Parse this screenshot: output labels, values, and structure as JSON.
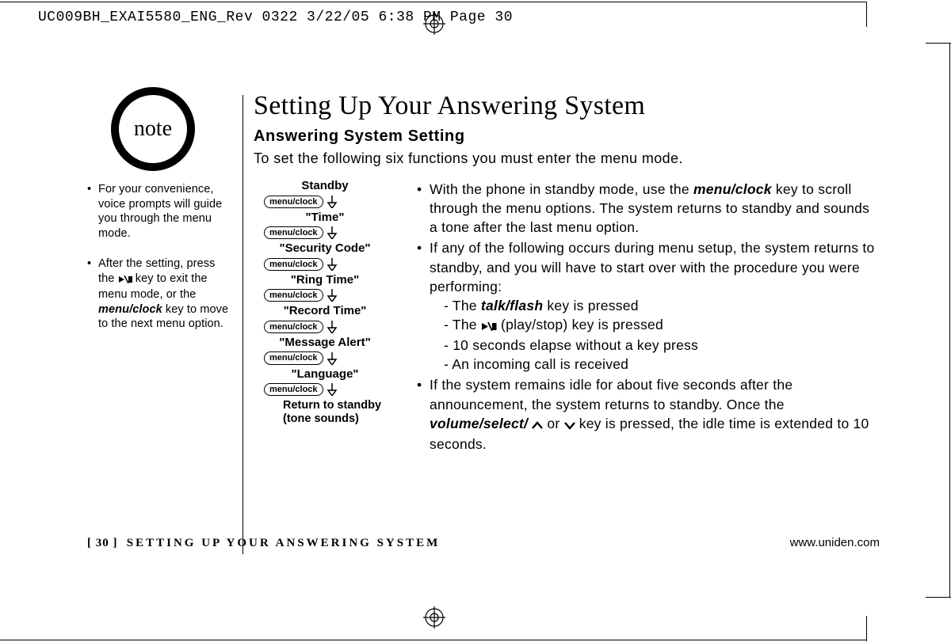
{
  "slug": "UC009BH_EXAI5580_ENG_Rev 0322  3/22/05  6:38 PM  Page 30",
  "note_badge": "note",
  "side_notes": {
    "item1": "For your convenience, voice prompts will guide you through the menu mode.",
    "item2_a": "After the setting, press the ",
    "item2_b": " key to exit the menu mode, or the ",
    "item2_c": "menu/clock",
    "item2_d": " key to move to the next menu option."
  },
  "headings": {
    "h1": "Setting Up Your Answering System",
    "h2": "Answering System Setting",
    "intro": "To set the following six functions you must enter the menu mode."
  },
  "button_label": "menu/clock",
  "flow": {
    "s0": "Standby",
    "s1": "\"Time\"",
    "s2": "\"Security Code\"",
    "s3": "\"Ring Time\"",
    "s4": "\"Record Time\"",
    "s5": "\"Message Alert\"",
    "s6": "\"Language\"",
    "final1": "Return to standby",
    "final2": "(tone sounds)"
  },
  "body": {
    "b1_a": "With the phone in standby mode, use the ",
    "b1_key": "menu/clock",
    "b1_b": " key to scroll through the menu options. The system returns to standby and sounds a tone after the last menu option.",
    "b2_a": "If any of the following occurs during menu setup, the system returns to standby, and you will have to start over with the procedure you were performing:",
    "b2_s1_a": "The ",
    "b2_s1_key": "talk/flash",
    "b2_s1_b": " key is pressed",
    "b2_s2_a": "The ",
    "b2_s2_b": " (play/stop) key is pressed",
    "b2_s3": "10 seconds elapse without a key press",
    "b2_s4": "An incoming call is received",
    "b3_a": "If the system remains idle for about five seconds after the announcement, the system returns to standby. Once the ",
    "b3_key": "volume/select/",
    "b3_b": " or ",
    "b3_c": " key is pressed, the idle time is extended to 10 seconds."
  },
  "footer": {
    "page_bracket": "[ 30 ]",
    "section": "SETTING UP YOUR ANSWERING SYSTEM",
    "url": "www.uniden.com"
  }
}
